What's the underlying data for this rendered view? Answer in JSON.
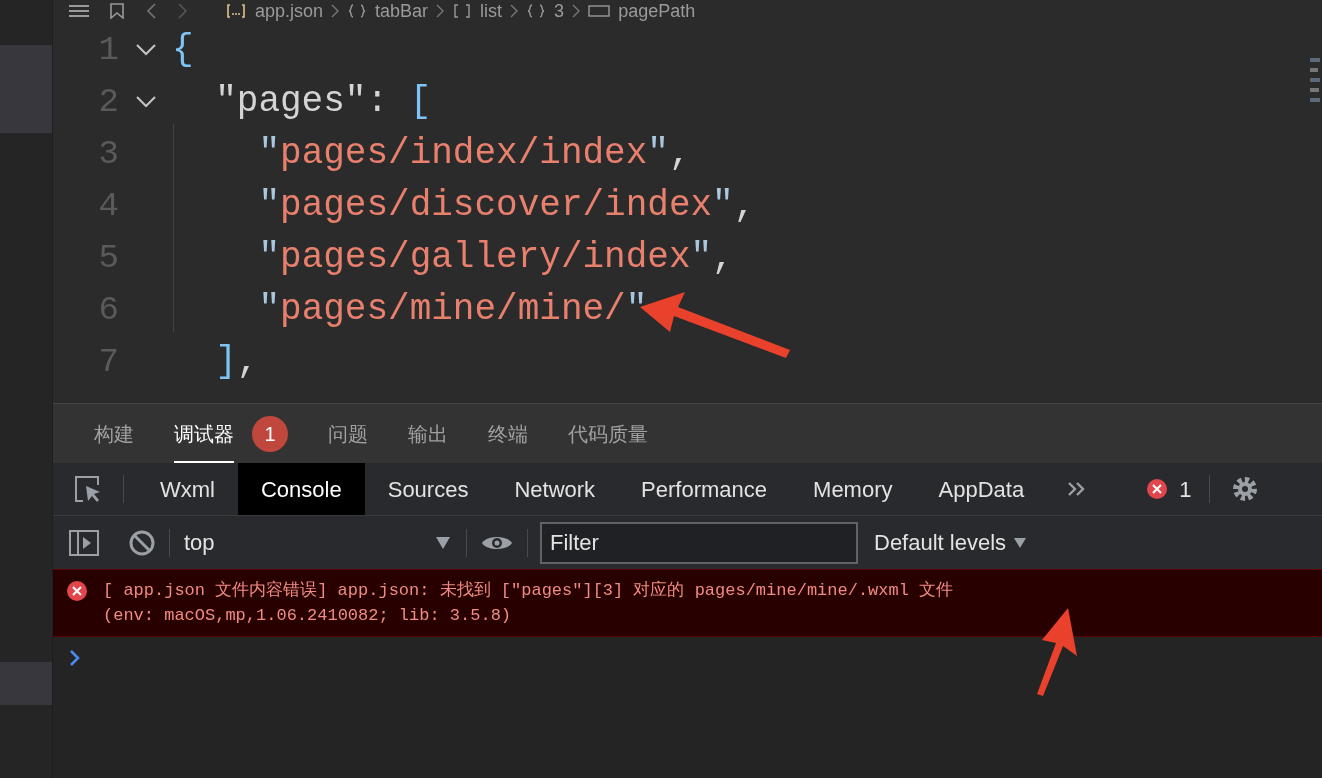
{
  "breadcrumb": [
    {
      "text": "app.json",
      "kind": "file"
    },
    {
      "text": "tabBar",
      "kind": "object"
    },
    {
      "text": "list",
      "kind": "array"
    },
    {
      "text": "3",
      "kind": "object"
    },
    {
      "text": "pagePath",
      "kind": "field"
    }
  ],
  "editor": {
    "lines": [
      {
        "number": "1",
        "foldable": true,
        "tokens": [
          {
            "text": "{",
            "kind": "bracket"
          }
        ]
      },
      {
        "number": "2",
        "foldable": true,
        "tokens": [
          {
            "text": "  \"pages\"",
            "kind": "key"
          },
          {
            "text": ": ",
            "kind": "punct"
          },
          {
            "text": "[",
            "kind": "bracket"
          }
        ]
      },
      {
        "number": "3",
        "foldable": false,
        "tokens": [
          {
            "text": "    \"",
            "kind": "quote"
          },
          {
            "text": "pages/index/index",
            "kind": "string"
          },
          {
            "text": "\"",
            "kind": "quote"
          },
          {
            "text": ",",
            "kind": "punct"
          }
        ]
      },
      {
        "number": "4",
        "foldable": false,
        "tokens": [
          {
            "text": "    \"",
            "kind": "quote"
          },
          {
            "text": "pages/discover/index",
            "kind": "string"
          },
          {
            "text": "\"",
            "kind": "quote"
          },
          {
            "text": ",",
            "kind": "punct"
          }
        ]
      },
      {
        "number": "5",
        "foldable": false,
        "tokens": [
          {
            "text": "    \"",
            "kind": "quote"
          },
          {
            "text": "pages/gallery/index",
            "kind": "string"
          },
          {
            "text": "\"",
            "kind": "quote"
          },
          {
            "text": ",",
            "kind": "punct"
          }
        ]
      },
      {
        "number": "6",
        "foldable": false,
        "tokens": [
          {
            "text": "    \"",
            "kind": "quote"
          },
          {
            "text": "pages/mine/mine/",
            "kind": "string"
          },
          {
            "text": "\"",
            "kind": "quote"
          }
        ]
      },
      {
        "number": "7",
        "foldable": false,
        "tokens": [
          {
            "text": "  ]",
            "kind": "bracket"
          },
          {
            "text": ",",
            "kind": "punct"
          }
        ]
      }
    ]
  },
  "panel_tabs": [
    {
      "label": "构建",
      "selected": false
    },
    {
      "label": "调试器",
      "selected": true,
      "badge": "1"
    },
    {
      "label": "问题",
      "selected": false
    },
    {
      "label": "输出",
      "selected": false
    },
    {
      "label": "终端",
      "selected": false
    },
    {
      "label": "代码质量",
      "selected": false
    }
  ],
  "devtools_tabs": [
    {
      "label": "Wxml",
      "selected": false
    },
    {
      "label": "Console",
      "selected": true
    },
    {
      "label": "Sources",
      "selected": false
    },
    {
      "label": "Network",
      "selected": false
    },
    {
      "label": "Performance",
      "selected": false
    },
    {
      "label": "Memory",
      "selected": false
    },
    {
      "label": "AppData",
      "selected": false
    }
  ],
  "error_count": "1",
  "toolbar": {
    "context": "top",
    "filter": {
      "placeholder": "Filter"
    },
    "levels": "Default levels"
  },
  "console": {
    "messages": [
      {
        "kind": "error",
        "lines": [
          "[ app.json 文件内容错误] app.json: 未找到 [\"pages\"][3] 对应的 pages/mine/mine/.wxml 文件",
          "(env: macOS,mp,1.06.2410082; lib: 3.5.8)"
        ]
      }
    ]
  }
}
